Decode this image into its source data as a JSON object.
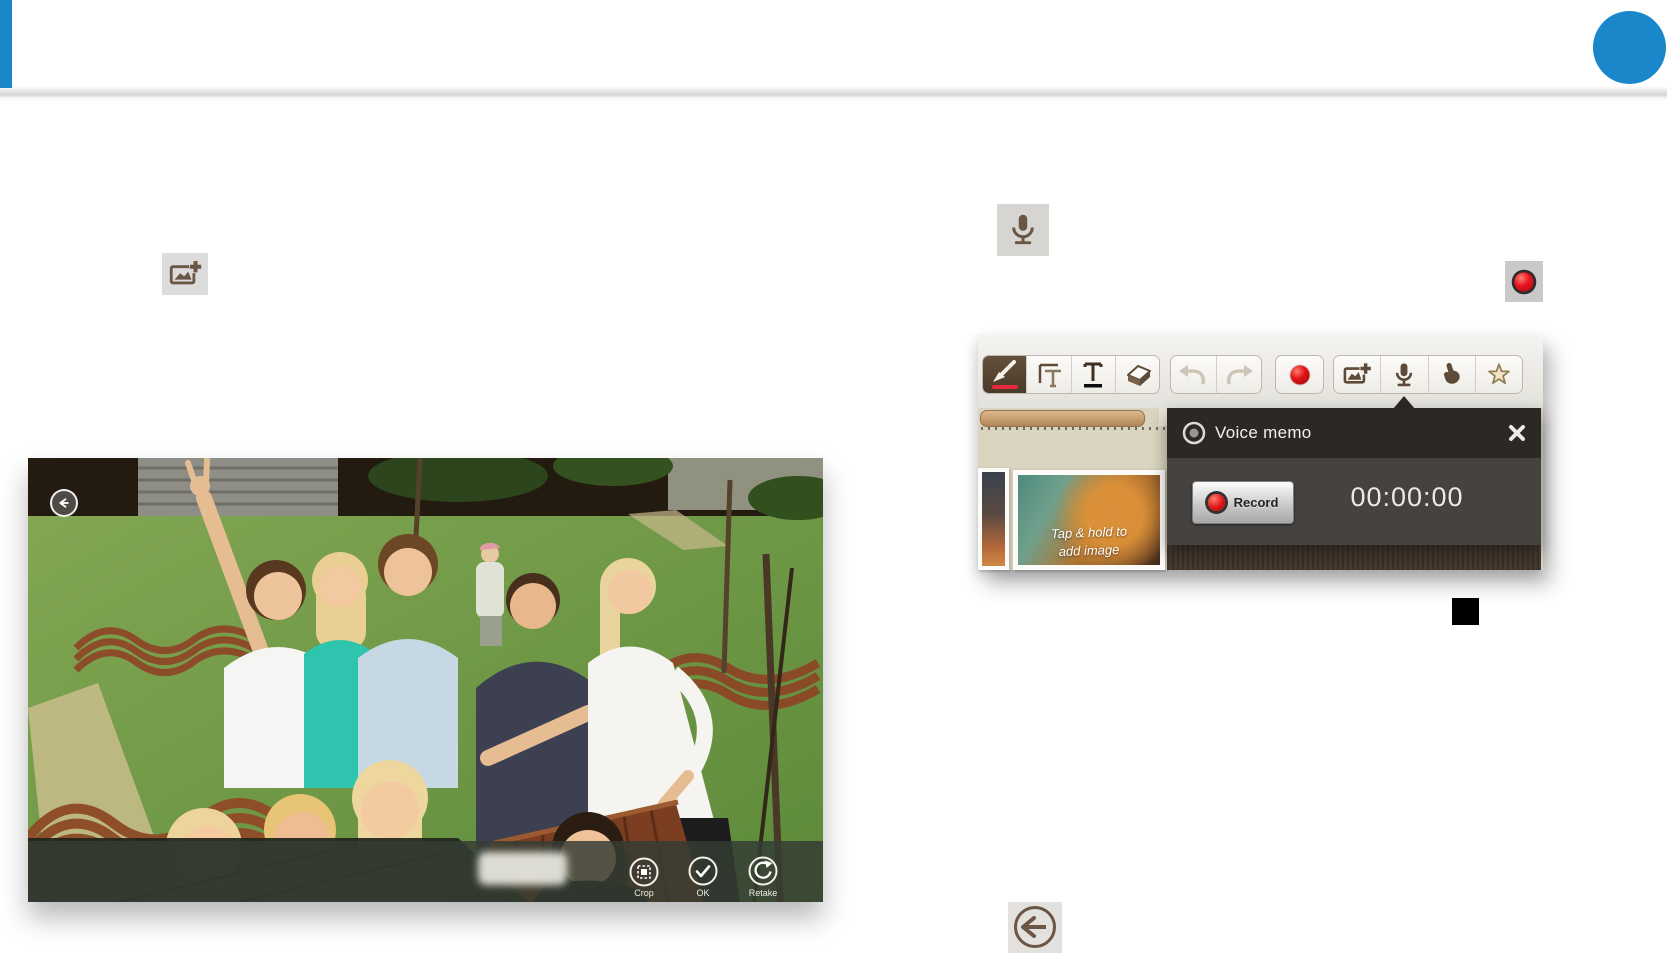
{
  "page": {
    "type": "user-guide page with embedded app screenshots",
    "background": "#ffffff",
    "accent_blue": "#1987c9"
  },
  "standalone_icons": {
    "add_image": {
      "name": "add-image-icon",
      "color": "#6a5645",
      "bg": "#dcdcdc"
    },
    "microphone": {
      "name": "microphone-icon",
      "color": "#6a5645",
      "bg": "#d7d5d2"
    },
    "record": {
      "name": "record-icon",
      "color": "#e01420",
      "bg": "#c9c9c9"
    },
    "stop": {
      "name": "stop-icon",
      "color": "#000000"
    },
    "back": {
      "name": "back-icon",
      "color": "#6b5645",
      "bg": "#e3e1dd"
    }
  },
  "camera_preview": {
    "back_button_icon": "back-arrow-icon",
    "action_bar": {
      "buttons": [
        {
          "label": "Crop",
          "icon": "crop-icon"
        },
        {
          "label": "OK",
          "icon": "ok-check-icon"
        },
        {
          "label": "Retake",
          "icon": "retake-icon"
        }
      ]
    }
  },
  "snote_screenshot": {
    "toolbar": {
      "selected_tool": "brush",
      "icons": [
        "brush-icon",
        "insert-text-frame-icon",
        "text-icon",
        "eraser-icon",
        "undo-icon",
        "redo-icon",
        "record-icon",
        "insert-image-icon",
        "voice-memo-icon",
        "touch-mode-icon",
        "favorite-icon"
      ]
    },
    "note": {
      "image_placeholder_line1": "Tap & hold to",
      "image_placeholder_line2": "add image"
    },
    "voice_memo_popup": {
      "title": "Voice memo",
      "record_button_label": "Record",
      "elapsed_time": "00:00:00",
      "close_icon": "close-icon"
    }
  }
}
